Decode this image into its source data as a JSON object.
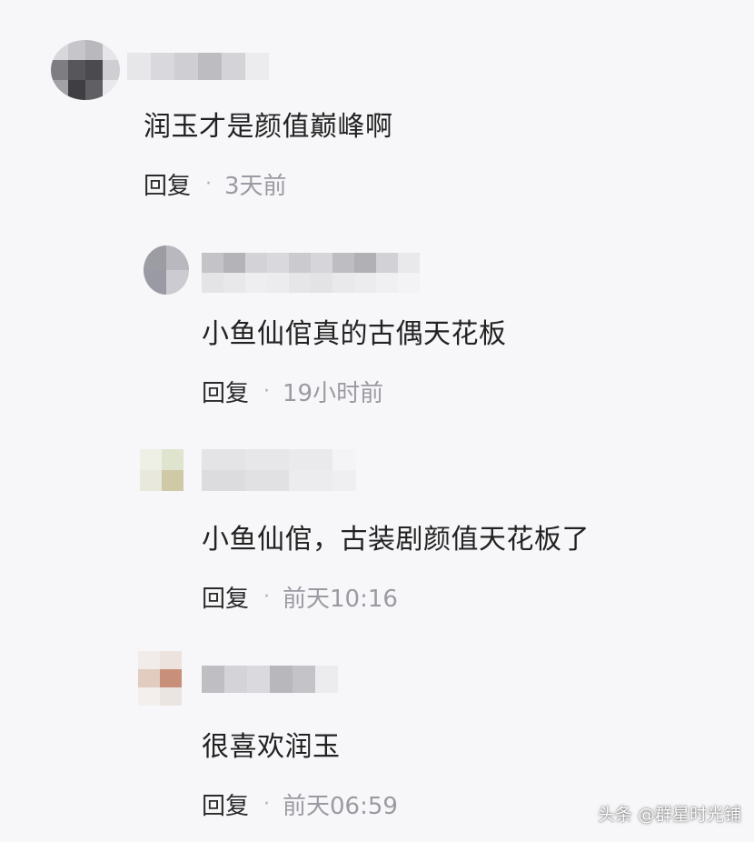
{
  "comments": [
    {
      "text": "润玉才是颜值巅峰啊",
      "reply_label": "回复",
      "separator": "·",
      "time": "3天前"
    },
    {
      "text": "小鱼仙倌真的古偶天花板",
      "reply_label": "回复",
      "separator": "·",
      "time": "19小时前"
    },
    {
      "text": "小鱼仙倌，古装剧颜值天花板了",
      "reply_label": "回复",
      "separator": "·",
      "time": "前天10:16"
    },
    {
      "text": "很喜欢润玉",
      "reply_label": "回复",
      "separator": "·",
      "time": "前天06:59"
    }
  ],
  "watermark": "头条 @群星时光铺",
  "colors": {
    "background": "#f7f7f9",
    "text": "#222222",
    "meta": "#9a9aa2"
  }
}
